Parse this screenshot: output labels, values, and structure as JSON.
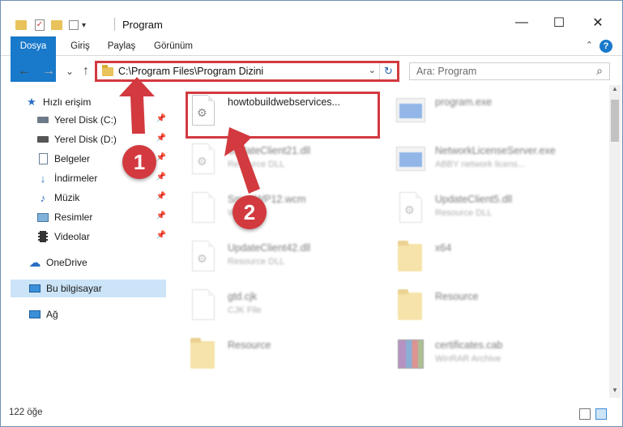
{
  "window": {
    "title": "Program",
    "minimize_glyph": "—",
    "maximize_glyph": "☐",
    "close_glyph": "✕"
  },
  "ribbon": {
    "tabs": [
      {
        "label": "Dosya"
      },
      {
        "label": "Giriş"
      },
      {
        "label": "Paylaş"
      },
      {
        "label": "Görünüm"
      }
    ],
    "help_glyph": "?"
  },
  "navigation": {
    "back_glyph": "←",
    "forward_glyph": "→",
    "recent_glyph": "⌄",
    "up_glyph": "↑",
    "address_path": "C:\\Program Files\\Program Dizini",
    "search_placeholder": "Ara: Program"
  },
  "sidebar": {
    "items": [
      {
        "label": "Hızlı erişim",
        "icon": "star-icon"
      },
      {
        "label": "Yerel Disk (C:)",
        "icon": "drive-icon"
      },
      {
        "label": "Yerel Disk (D:)",
        "icon": "drive-icon"
      },
      {
        "label": "Belgeler",
        "icon": "documents-icon"
      },
      {
        "label": "İndirmeler",
        "icon": "download-icon"
      },
      {
        "label": "Müzik",
        "icon": "music-icon"
      },
      {
        "label": "Resimler",
        "icon": "pictures-icon"
      },
      {
        "label": "Videolar",
        "icon": "video-icon"
      },
      {
        "label": "OneDrive",
        "icon": "cloud-icon"
      },
      {
        "label": "Bu bilgisayar",
        "icon": "computer-icon"
      },
      {
        "label": "Ağ",
        "icon": "network-icon"
      }
    ]
  },
  "files": [
    {
      "name": "howtobuildwebservices...",
      "type": "",
      "icon": "dll-icon"
    },
    {
      "name": "program.exe",
      "type": "",
      "icon": "exe-icon"
    },
    {
      "name": "UpdateClient21.dll",
      "type": "Resource DLL",
      "icon": "dll-icon"
    },
    {
      "name": "NetworkLicenseServer.exe",
      "type": "ABBY network licens...",
      "icon": "exe-icon"
    },
    {
      "name": "SmartWP12.wcm",
      "type": "WCM",
      "icon": "generic-file-icon"
    },
    {
      "name": "UpdateClient5.dll",
      "type": "Resource DLL",
      "icon": "dll-icon"
    },
    {
      "name": "UpdateClient42.dll",
      "type": "Resource DLL",
      "icon": "dll-icon"
    },
    {
      "name": "x64",
      "type": "",
      "icon": "folder-icon"
    },
    {
      "name": "gtd.cjk",
      "type": "CJK File",
      "icon": "generic-file-icon"
    },
    {
      "name": "Resource",
      "type": "",
      "icon": "folder-icon"
    },
    {
      "name": "Resource",
      "type": "",
      "icon": "folder-icon"
    },
    {
      "name": "certificates.cab",
      "type": "WinRAR Archive",
      "icon": "archive-icon"
    }
  ],
  "status": {
    "item_count": "122 öğe"
  },
  "callouts": [
    {
      "number": "1"
    },
    {
      "number": "2"
    }
  ],
  "colors": {
    "accent": "#1979ca",
    "highlight": "#d23a3f",
    "selected": "#cce4f7"
  }
}
